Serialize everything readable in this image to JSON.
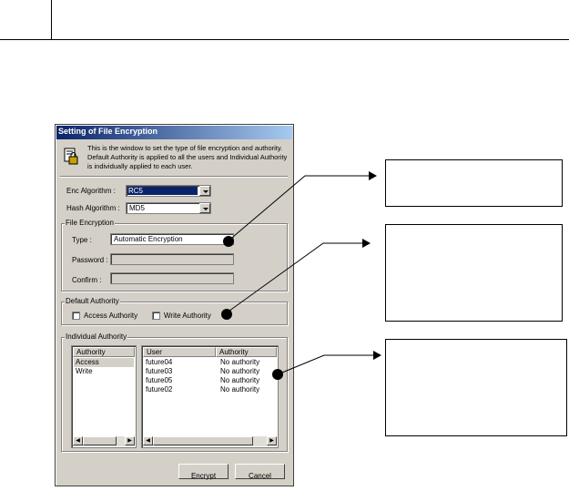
{
  "dialog": {
    "title": "Setting of File Encryption",
    "description": "This is the window to set the type of file encryption and authority. Default Authority is applied to all the users and Individual Authority is individually applied to each user.",
    "enc_algorithm": {
      "label": "Enc Algorithm :",
      "value": "RC5"
    },
    "hash_algorithm": {
      "label": "Hash Algorithm :",
      "value": "MD5"
    },
    "file_encryption": {
      "group_label": "File Encryption",
      "type_label": "Type :",
      "type_value": "Automatic Encryption",
      "password_label": "Password :",
      "confirm_label": "Confirm :"
    },
    "default_authority": {
      "group_label": "Default Authority",
      "access_label": "Access Authority",
      "write_label": "Write Authority"
    },
    "individual_authority": {
      "group_label": "Individual Authority",
      "authority_list": {
        "header": "Authority",
        "items": [
          "Access",
          "Write"
        ]
      },
      "user_table": {
        "columns": [
          "User",
          "Authority"
        ],
        "rows": [
          [
            "future04",
            "No authority"
          ],
          [
            "future03",
            "No authority"
          ],
          [
            "future05",
            "No authority"
          ],
          [
            "future02",
            "No authority"
          ]
        ]
      }
    },
    "buttons": {
      "encrypt": "Encrypt",
      "cancel": "Cancel"
    }
  },
  "colors": {
    "titlebar_start": "#0a246a",
    "titlebar_end": "#a6caf0",
    "selection": "#0a246a",
    "dialog_bg": "#d4d0c8"
  }
}
